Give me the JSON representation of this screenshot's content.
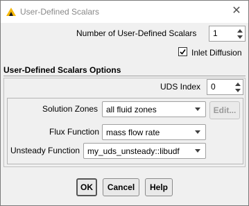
{
  "window": {
    "title": "User-Defined Scalars",
    "close_glyph": "✕"
  },
  "count": {
    "label": "Number of User-Defined Scalars",
    "value": "1"
  },
  "inlet_diffusion": {
    "label": "Inlet Diffusion",
    "checked": true
  },
  "options": {
    "title": "User-Defined Scalars Options"
  },
  "uds_index": {
    "label": "UDS Index",
    "value": "0"
  },
  "solution_zones": {
    "label": "Solution Zones",
    "value": "all fluid zones",
    "edit_label": "Edit..."
  },
  "flux_function": {
    "label": "Flux Function",
    "value": "mass flow rate"
  },
  "unsteady_function": {
    "label": "Unsteady Function",
    "value": "my_uds_unsteady::libudf"
  },
  "buttons": {
    "ok": "OK",
    "cancel": "Cancel",
    "help": "Help"
  },
  "icons": {
    "app": "ansys-fluent-icon",
    "close": "close-icon"
  },
  "colors": {
    "app_icon_primary": "#f5b80a",
    "app_icon_secondary": "#1a1a1a"
  }
}
